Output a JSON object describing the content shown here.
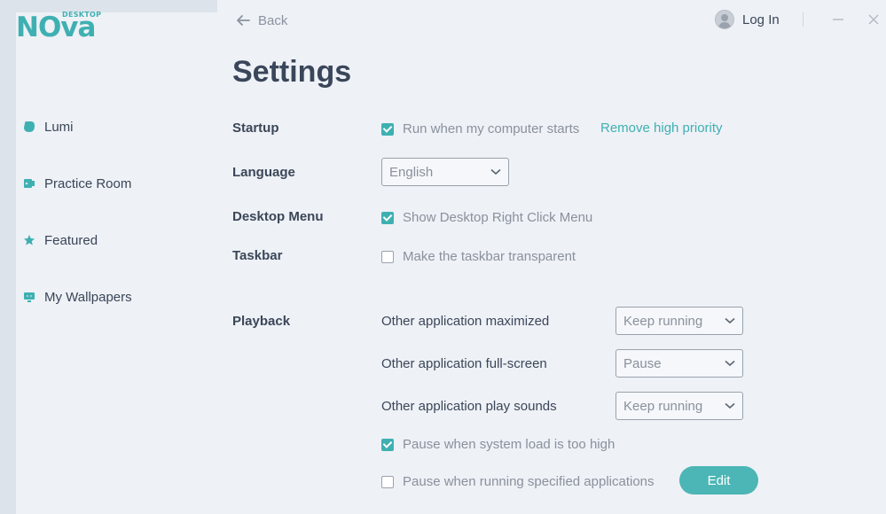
{
  "logo": {
    "main": "NOva",
    "sub": "DESKTOP"
  },
  "sidebar": {
    "items": [
      {
        "label": "Lumi",
        "icon": "lumi-icon"
      },
      {
        "label": "Practice Room",
        "icon": "practice-room-icon"
      },
      {
        "label": "Featured",
        "icon": "star-icon"
      },
      {
        "label": "My Wallpapers",
        "icon": "monitor-icon"
      }
    ]
  },
  "header": {
    "back_label": "Back",
    "login_label": "Log In"
  },
  "page": {
    "title": "Settings"
  },
  "settings": {
    "startup": {
      "label": "Startup",
      "run_on_start": {
        "label": "Run when my computer starts",
        "checked": true
      },
      "remove_priority_link": "Remove high priority"
    },
    "language": {
      "label": "Language",
      "value": "English"
    },
    "desktop_menu": {
      "label": "Desktop Menu",
      "show_right_click": {
        "label": "Show Desktop Right Click Menu",
        "checked": true
      }
    },
    "taskbar": {
      "label": "Taskbar",
      "transparent": {
        "label": "Make the taskbar transparent",
        "checked": false
      }
    },
    "playback": {
      "label": "Playback",
      "maximized": {
        "label": "Other application maximized",
        "value": "Keep running"
      },
      "fullscreen": {
        "label": "Other application full-screen",
        "value": "Pause"
      },
      "sounds": {
        "label": "Other application play sounds",
        "value": "Keep running"
      },
      "pause_load": {
        "label": "Pause when system load is too high",
        "checked": true
      },
      "pause_apps": {
        "label": "Pause when running specified applications",
        "checked": false
      },
      "edit_label": "Edit"
    }
  },
  "colors": {
    "accent": "#3fb0b2",
    "sidebar_bg": "#dde3ea",
    "main_bg": "#eef1f6"
  }
}
